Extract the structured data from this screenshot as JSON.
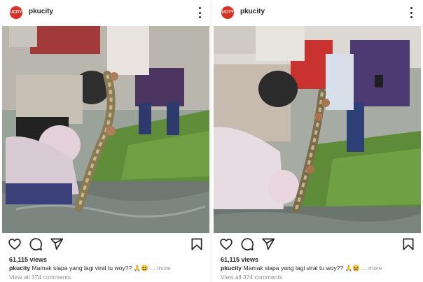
{
  "posts": [
    {
      "username": "pkucity",
      "avatar_text": "UCITY",
      "views": "61,115 views",
      "caption_user": "pkucity",
      "caption_text": "Mamak siapa yang lagi viral tu woy?? 🙏😆",
      "more_label": "... more",
      "comments_label": "View all 374 comments"
    },
    {
      "username": "pkucity",
      "avatar_text": "UCITY",
      "views": "61,115 views",
      "caption_user": "pkucity",
      "caption_text": "Mamak siapa yang lagi viral tu woy?? 🙏😆",
      "more_label": "... more",
      "comments_label": "View all 374 comments"
    }
  ],
  "icons": [
    "heart-icon",
    "comment-icon",
    "share-icon",
    "bookmark-icon",
    "more-options-icon"
  ],
  "colors": {
    "brand_avatar": "#d93025",
    "text": "#262626",
    "muted": "#8e8e8e"
  }
}
